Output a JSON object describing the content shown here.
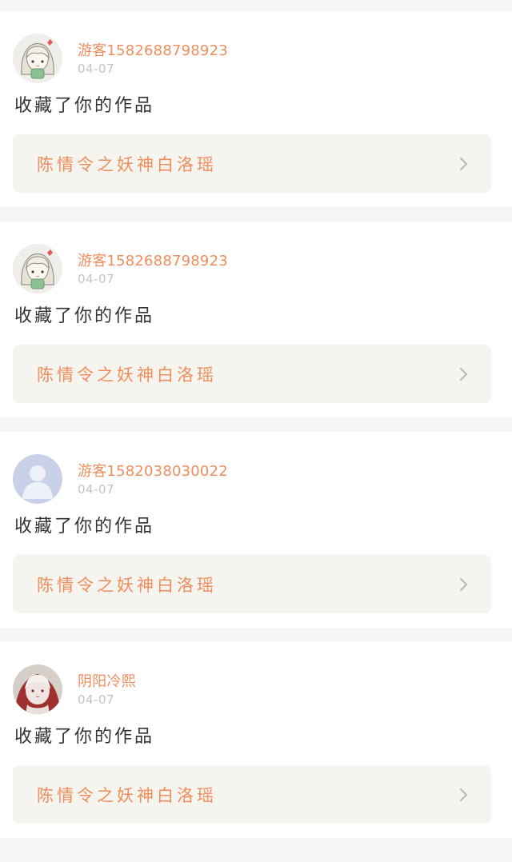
{
  "colors": {
    "page_background": "#f7f5f6",
    "card_background": "#ffffff",
    "accent_orange": "#ef8d5d",
    "date_gray": "#c6c2bf",
    "text_dark": "#333333",
    "work_box_background": "#f5f4ee",
    "chevron_gray": "#b9b9b9"
  },
  "notifications": [
    {
      "avatar_icon": "anime-girl-avatar-icon",
      "username": "游客15826887989​23",
      "date": "04-07",
      "action": "收藏了你的作品",
      "work_title": "陈情令之妖神白洛瑶",
      "chevron_icon": "chevron-right-icon"
    },
    {
      "avatar_icon": "anime-girl-avatar-icon",
      "username": "游客15826887989​23",
      "date": "04-07",
      "action": "收藏了你的作品",
      "work_title": "陈情令之妖神白洛瑶",
      "chevron_icon": "chevron-right-icon"
    },
    {
      "avatar_icon": "default-user-avatar-icon",
      "username": "游客15820380300​22",
      "date": "04-07",
      "action": "收藏了你的作品",
      "work_title": "陈情令之妖神白洛瑶",
      "chevron_icon": "chevron-right-icon"
    },
    {
      "avatar_icon": "anime-character-avatar-icon",
      "username": "阴阳冷熙",
      "date": "04-07",
      "action": "收藏了你的作品",
      "work_title": "陈情令之妖神白洛瑶",
      "chevron_icon": "chevron-right-icon"
    }
  ]
}
